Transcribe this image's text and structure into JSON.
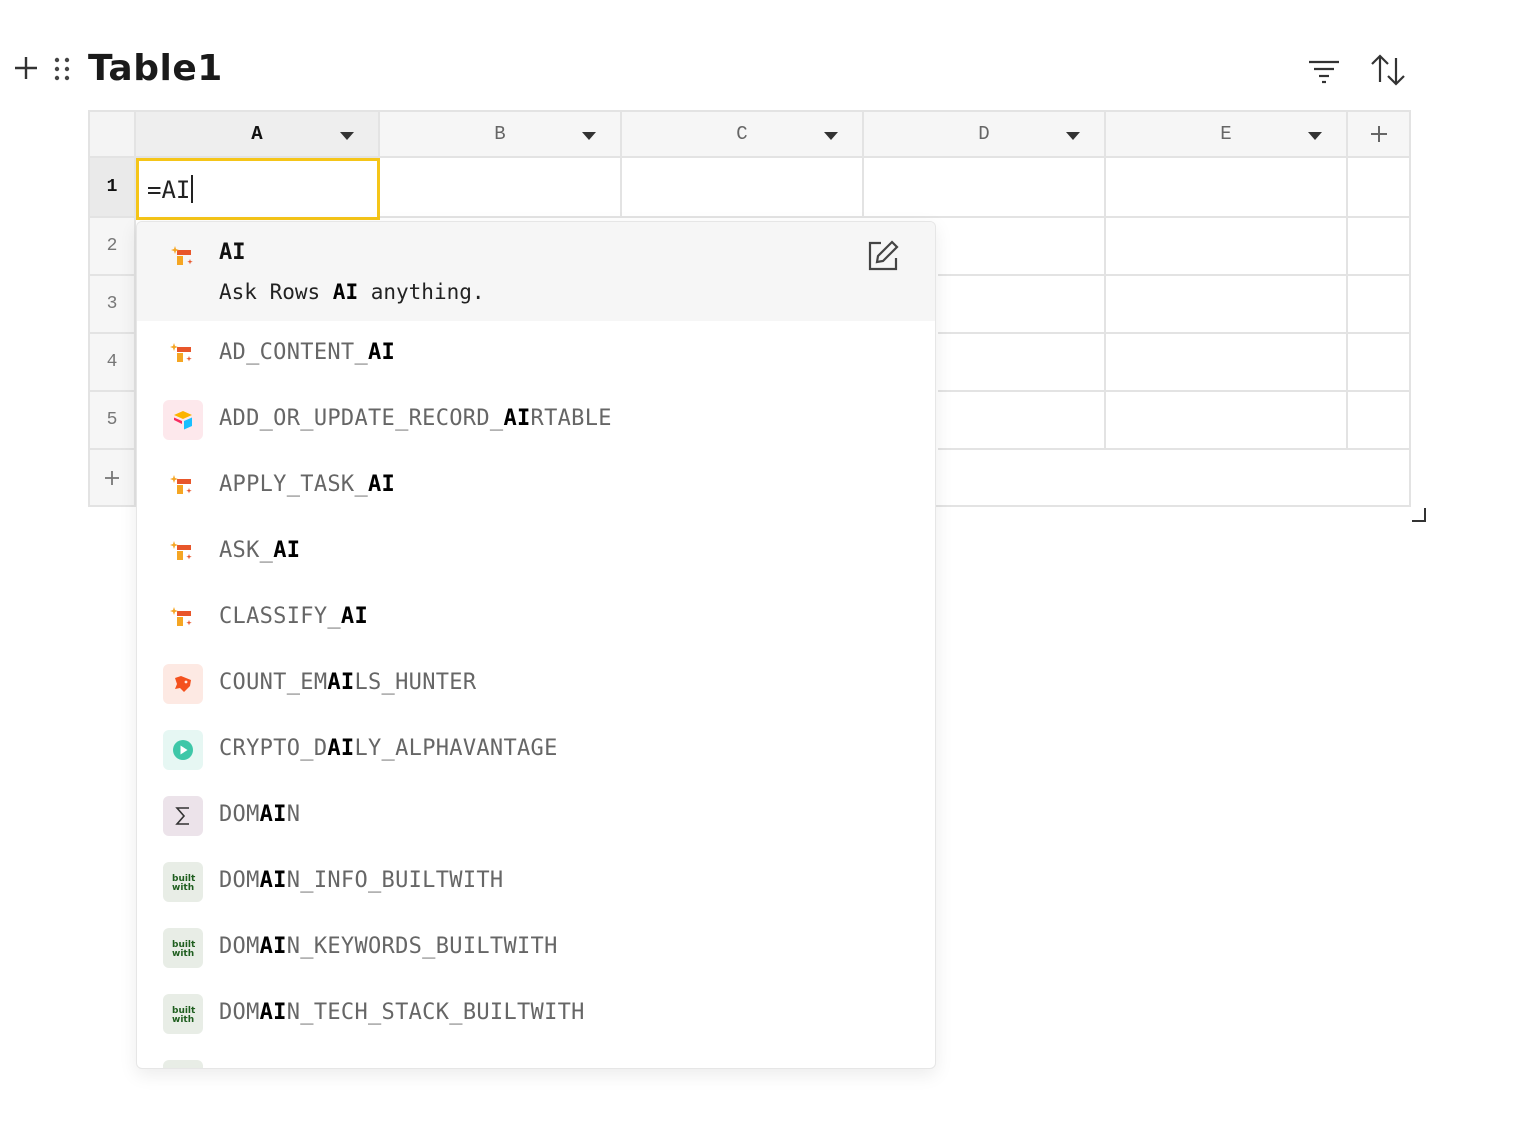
{
  "table": {
    "title": "Table1"
  },
  "columns": [
    {
      "label": "A"
    },
    {
      "label": "B"
    },
    {
      "label": "C"
    },
    {
      "label": "D"
    },
    {
      "label": "E"
    }
  ],
  "rows": [
    {
      "label": "1"
    },
    {
      "label": "2"
    },
    {
      "label": "3"
    },
    {
      "label": "4"
    },
    {
      "label": "5"
    }
  ],
  "editor": {
    "value": "=AI"
  },
  "colors": {
    "editor_border": "#f5c518",
    "highlight_bg": "#f6f6f6",
    "grid_border": "#e3e3e3"
  },
  "suggestions": {
    "top": {
      "name": "AI",
      "desc_pre": "Ask Rows ",
      "desc_bold": "AI",
      "desc_post": " anything.",
      "icon": "rows-ai-icon"
    },
    "items": [
      {
        "pre": "AD_CONTENT_",
        "bold": "AI",
        "post": "",
        "icon": "rows-ai-icon"
      },
      {
        "pre": "ADD_OR_UPDATE_RECORD_",
        "bold": "AI",
        "post": "RTABLE",
        "icon": "airtable-icon"
      },
      {
        "pre": "APPLY_TASK_",
        "bold": "AI",
        "post": "",
        "icon": "rows-ai-icon"
      },
      {
        "pre": "ASK_",
        "bold": "AI",
        "post": "",
        "icon": "rows-ai-icon"
      },
      {
        "pre": "CLASSIFY_",
        "bold": "AI",
        "post": "",
        "icon": "rows-ai-icon"
      },
      {
        "pre": "COUNT_EM",
        "bold": "AI",
        "post": "LS_HUNTER",
        "icon": "hunter-icon"
      },
      {
        "pre": "CRYPTO_D",
        "bold": "AI",
        "post": "LY_ALPHAVANTAGE",
        "icon": "alphavantage-icon"
      },
      {
        "pre": "DOM",
        "bold": "AI",
        "post": "N",
        "icon": "sigma-icon"
      },
      {
        "pre": "DOM",
        "bold": "AI",
        "post": "N_INFO_BUILTWITH",
        "icon": "builtwith-icon"
      },
      {
        "pre": "DOM",
        "bold": "AI",
        "post": "N_KEYWORDS_BUILTWITH",
        "icon": "builtwith-icon"
      },
      {
        "pre": "DOM",
        "bold": "AI",
        "post": "N_TECH_STACK_BUILTWITH",
        "icon": "builtwith-icon"
      }
    ]
  }
}
